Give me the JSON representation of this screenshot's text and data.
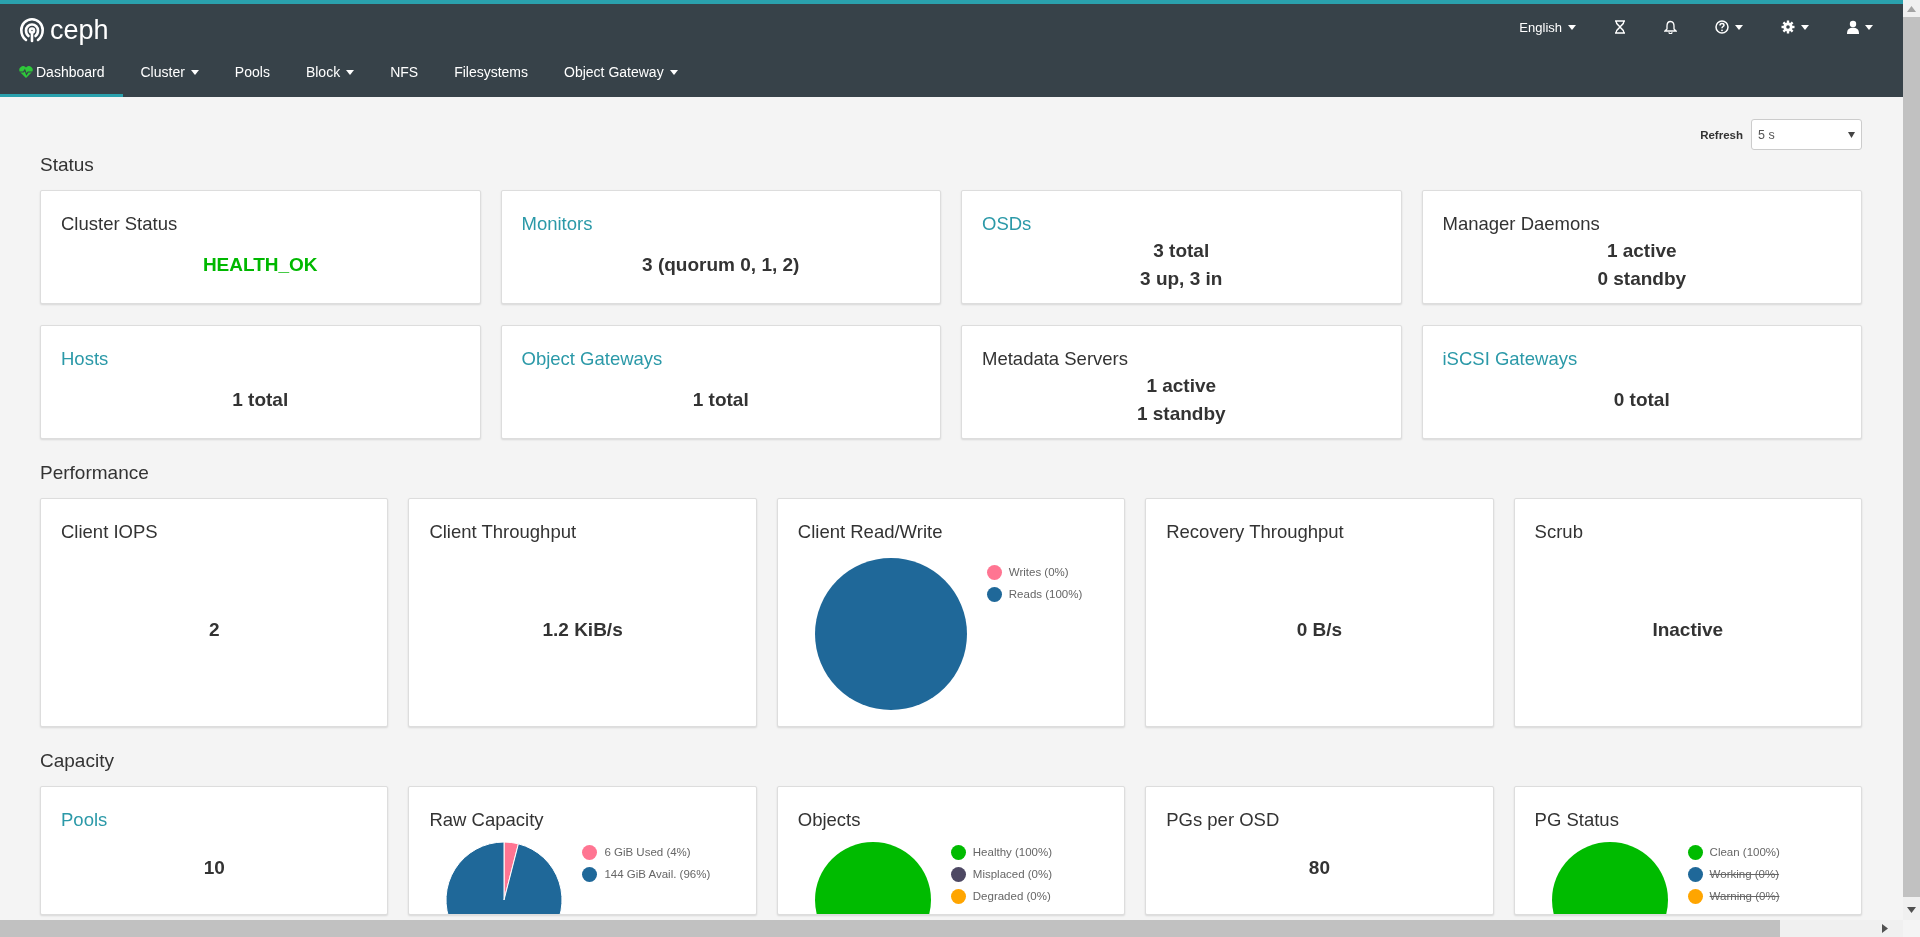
{
  "brand": {
    "name": "ceph"
  },
  "top_menu": [
    {
      "kind": "language",
      "label": "English",
      "dropdown": true
    },
    {
      "kind": "hourglass",
      "dropdown": false
    },
    {
      "kind": "bell",
      "dropdown": false
    },
    {
      "kind": "help",
      "dropdown": true
    },
    {
      "kind": "settings",
      "dropdown": true
    },
    {
      "kind": "user",
      "dropdown": true
    }
  ],
  "nav": [
    {
      "label": "Dashboard",
      "selected": true,
      "dropdown": false
    },
    {
      "label": "Cluster",
      "selected": false,
      "dropdown": true
    },
    {
      "label": "Pools",
      "selected": false,
      "dropdown": false
    },
    {
      "label": "Block",
      "selected": false,
      "dropdown": true
    },
    {
      "label": "NFS",
      "selected": false,
      "dropdown": false
    },
    {
      "label": "Filesystems",
      "selected": false,
      "dropdown": false
    },
    {
      "label": "Object Gateway",
      "selected": false,
      "dropdown": true
    }
  ],
  "refresh": {
    "label": "Refresh",
    "value": "5 s"
  },
  "sections": [
    {
      "title": "Status",
      "cards": [
        {
          "kind": "text",
          "title": "Cluster Status",
          "link": false,
          "color": "#00b800",
          "lines": [
            "HEALTH_OK"
          ]
        },
        {
          "kind": "text",
          "title": "Monitors",
          "link": true,
          "lines": [
            "3 (quorum 0, 1, 2)"
          ]
        },
        {
          "kind": "text",
          "title": "OSDs",
          "link": true,
          "lines": [
            "3 total",
            "3 up, 3 in"
          ]
        },
        {
          "kind": "text",
          "title": "Manager Daemons",
          "link": false,
          "lines": [
            "1 active",
            "0 standby"
          ]
        },
        {
          "kind": "text",
          "title": "Hosts",
          "link": true,
          "lines": [
            "1 total"
          ]
        },
        {
          "kind": "text",
          "title": "Object Gateways",
          "link": true,
          "lines": [
            "1 total"
          ]
        },
        {
          "kind": "text",
          "title": "Metadata Servers",
          "link": false,
          "lines": [
            "1 active",
            "1 standby"
          ]
        },
        {
          "kind": "text",
          "title": "iSCSI Gateways",
          "link": true,
          "lines": [
            "0 total"
          ]
        }
      ]
    },
    {
      "title": "Performance",
      "cards": [
        {
          "kind": "text",
          "title": "Client IOPS",
          "link": false,
          "lines": [
            "2"
          ]
        },
        {
          "kind": "text",
          "title": "Client Throughput",
          "link": false,
          "lines": [
            "1.2 KiB/s"
          ]
        },
        {
          "kind": "pie",
          "title": "Client Read/Write",
          "link": false,
          "legend": [
            {
              "color": "#ff7592",
              "hidden": false
            },
            {
              "color": "#1f6899",
              "hidden": false
            }
          ],
          "chart_data": {
            "type": "pie",
            "legend": "right",
            "categories": [
              "Writes (0%)",
              "Reads (100%)"
            ],
            "values": [
              0,
              100
            ]
          }
        },
        {
          "kind": "text",
          "title": "Recovery Throughput",
          "link": false,
          "lines": [
            "0 B/s"
          ]
        },
        {
          "kind": "text",
          "title": "Scrub",
          "link": false,
          "lines": [
            "Inactive"
          ]
        }
      ]
    },
    {
      "title": "Capacity",
      "cards": [
        {
          "kind": "text",
          "title": "Pools",
          "link": true,
          "lines": [
            "10"
          ]
        },
        {
          "kind": "pie",
          "title": "Raw Capacity",
          "link": false,
          "legend": [
            {
              "color": "#ff7592",
              "hidden": false
            },
            {
              "color": "#1f6899",
              "hidden": false
            }
          ],
          "chart_data": {
            "type": "pie",
            "legend": "right",
            "categories": [
              "6 GiB Used (4%)",
              "144 GiB Avail. (96%)"
            ],
            "values": [
              4,
              96
            ]
          }
        },
        {
          "kind": "pie",
          "title": "Objects",
          "link": false,
          "legend": [
            {
              "color": "#00bb00",
              "hidden": false
            },
            {
              "color": "#4d4863",
              "hidden": false
            },
            {
              "color": "#ffa500",
              "hidden": false
            }
          ],
          "chart_data": {
            "type": "pie",
            "legend": "right",
            "categories": [
              "Healthy (100%)",
              "Misplaced (0%)",
              "Degraded (0%)"
            ],
            "values": [
              100,
              0,
              0
            ]
          }
        },
        {
          "kind": "text",
          "title": "PGs per OSD",
          "link": false,
          "lines": [
            "80"
          ]
        },
        {
          "kind": "pie",
          "title": "PG Status",
          "link": false,
          "legend": [
            {
              "color": "#00bb00",
              "hidden": false
            },
            {
              "color": "#1f6899",
              "hidden": true
            },
            {
              "color": "#ffa500",
              "hidden": true
            }
          ],
          "chart_data": {
            "type": "pie",
            "legend": "right",
            "categories": [
              "Clean (100%)",
              "Working (0%)",
              "Warning (0%)"
            ],
            "values": [
              100,
              0,
              0
            ]
          }
        }
      ]
    }
  ]
}
